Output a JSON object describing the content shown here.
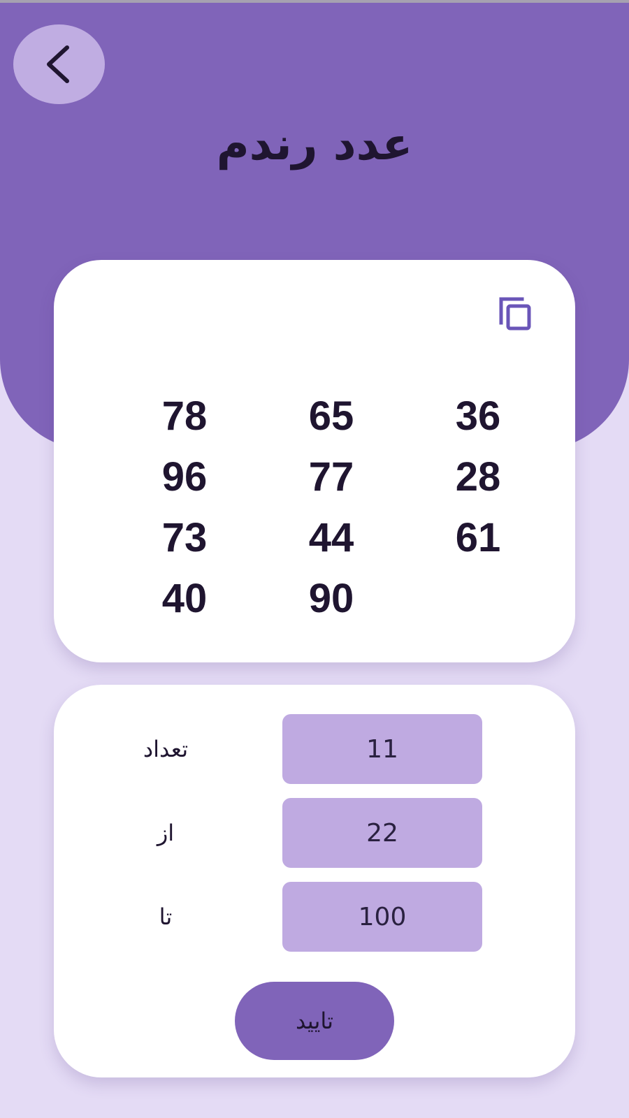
{
  "header": {
    "title": "عدد رندم",
    "back_icon": "chevron-left-icon"
  },
  "result": {
    "copy_icon": "copy-icon",
    "numbers": [
      "36",
      "65",
      "78",
      "28",
      "77",
      "96",
      "61",
      "44",
      "73",
      "",
      "90",
      "40"
    ]
  },
  "form": {
    "count": {
      "label": "تعداد",
      "value": "11"
    },
    "from": {
      "label": "از",
      "value": "22"
    },
    "to": {
      "label": "تا",
      "value": "100"
    },
    "confirm_label": "تایید"
  },
  "colors": {
    "header": "#8064b9",
    "background": "#e4dbf5",
    "field": "#bfaae1",
    "back_button": "#c0ade2",
    "text": "#1f1530",
    "copy_icon": "#6a55b8"
  }
}
